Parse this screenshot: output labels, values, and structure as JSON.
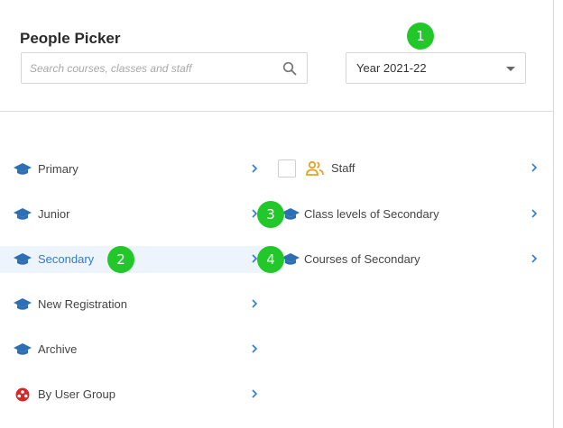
{
  "header": {
    "title": "People Picker",
    "search_placeholder": "Search courses, classes and staff",
    "year_value": "Year 2021-22"
  },
  "badges": [
    "1",
    "2",
    "3",
    "4"
  ],
  "left_items": [
    {
      "label": "Primary",
      "icon": "graduation-cap-icon",
      "active": false
    },
    {
      "label": "Junior",
      "icon": "graduation-cap-icon",
      "active": false
    },
    {
      "label": "Secondary",
      "icon": "graduation-cap-icon",
      "active": true
    },
    {
      "label": "New Registration",
      "icon": "graduation-cap-icon",
      "active": false
    },
    {
      "label": "Archive",
      "icon": "graduation-cap-icon",
      "active": false
    },
    {
      "label": "By User Group",
      "icon": "user-group-icon",
      "active": false
    }
  ],
  "right_items": [
    {
      "label": "Staff",
      "icon": "staff-icon"
    },
    {
      "label": "Class levels of Secondary",
      "icon": "graduation-cap-icon"
    },
    {
      "label": "Courses of Secondary",
      "icon": "graduation-cap-icon"
    }
  ],
  "colors": {
    "accent": "#2f7bd6",
    "badge": "#22c72a",
    "active_bg": "#eef4fb",
    "staff_icon": "#e8a020",
    "group_icon": "#d9262b"
  }
}
